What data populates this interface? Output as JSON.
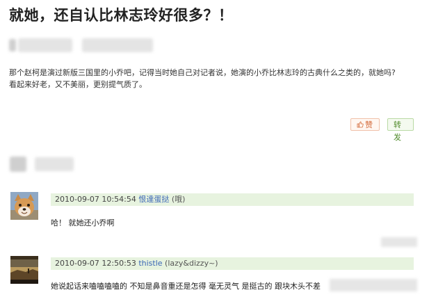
{
  "post": {
    "title": "就她，还自认比林志玲好很多？！",
    "body_line1": "那个赵柯是演过新版三国里的小乔吧，记得当时她自己对记者说，她演的小乔比林志玲的古典什么之类的，就她吗?",
    "body_line2": "看起来好老，又不美丽，更别提气质了。",
    "like_label": "赞",
    "share_label": "转发"
  },
  "comments": [
    {
      "timestamp": "2010-09-07 10:54:54",
      "user": "恨達蛋挞",
      "note": "(哦)",
      "avatar": "shiba-dog-avatar",
      "text": "哈！ 就她还小乔啊"
    },
    {
      "timestamp": "2010-09-07 12:50:53",
      "user": "thistle",
      "note": "(lazy&dizzy~)",
      "avatar": "landscape-avatar",
      "text": "她说起话来嗑嗑嗑嗑的 不知是鼻音重还是怎得 毫无灵气 是挺古的 跟块木头不差"
    }
  ],
  "colors": {
    "meta_bar_bg": "#e7f3df",
    "username": "#3b67b5",
    "like_accent": "#d36a3a",
    "share_accent": "#4f8a2a"
  }
}
